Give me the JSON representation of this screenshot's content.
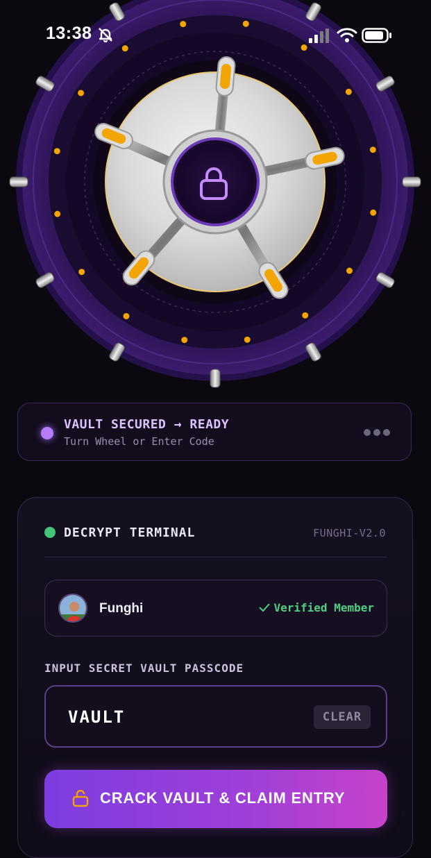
{
  "status_bar": {
    "time": "13:38",
    "icons": [
      "bell-muted-icon",
      "cellular-signal-icon",
      "wifi-icon",
      "battery-icon"
    ]
  },
  "vault": {
    "center_icon": "lock-icon",
    "colors": {
      "ring": "#3b1c6e",
      "accent": "#f2a400",
      "lock": "#c48cff"
    }
  },
  "status_card": {
    "title": "VAULT SECURED → READY",
    "subtitle": "Turn Wheel or Enter Code",
    "indicator_color": "#b47cf7",
    "more_icon": "more-dots-icon"
  },
  "terminal": {
    "title": "DECRYPT TERMINAL",
    "version": "FUNGHI-V2.0",
    "indicator_color": "#43c57a",
    "user": {
      "name": "Funghi",
      "badge": "Verified Member",
      "badge_icon": "check-icon"
    },
    "passcode": {
      "label": "INPUT SECRET VAULT PASSCODE",
      "value": "VAULT",
      "clear_label": "CLEAR"
    },
    "action": {
      "label": "CRACK VAULT & CLAIM ENTRY",
      "icon": "unlock-icon"
    }
  }
}
